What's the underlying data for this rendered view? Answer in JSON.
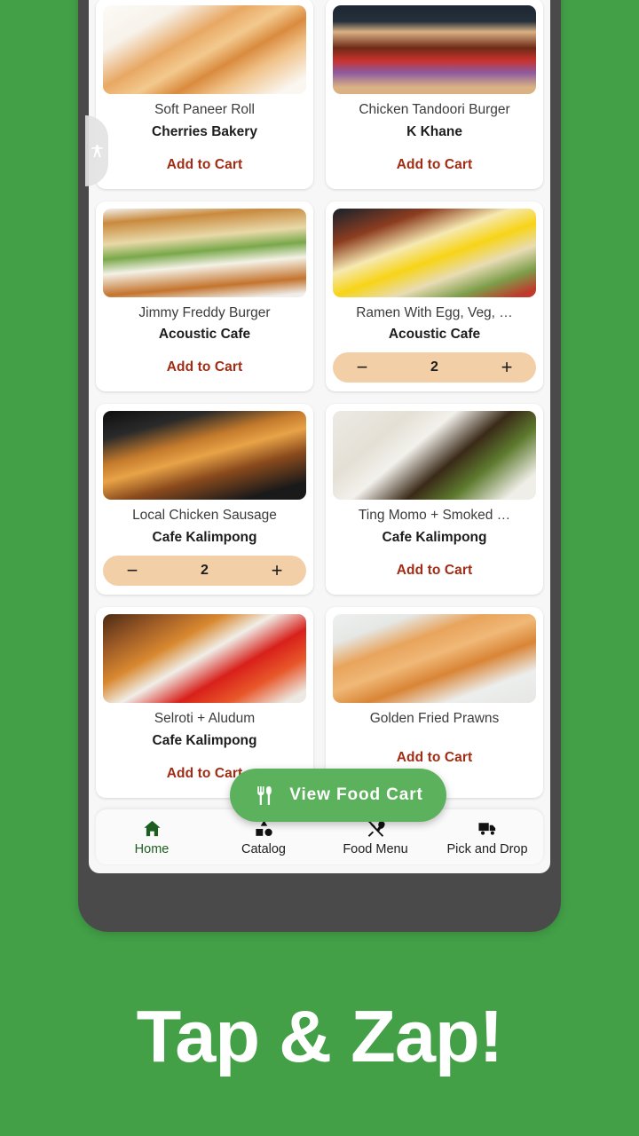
{
  "theme": {
    "background_green": "#43a047",
    "frame_gray": "#4a4a4a",
    "screen_bg": "#f7f7f7",
    "add_to_cart_red": "#a02c14",
    "stepper_peach": "#f2cfa7",
    "cart_button_green": "#5cb25c",
    "active_nav_green": "#1b5e20"
  },
  "accessibility_tab": {
    "icon": "accessibility-icon"
  },
  "products": {
    "rows": [
      {
        "partial": true,
        "cards": [
          {
            "title": "",
            "vendor": "",
            "photo": "",
            "action": "none"
          },
          {
            "title": "",
            "vendor": "",
            "photo": "",
            "action": "none"
          }
        ]
      },
      {
        "partial": false,
        "cards": [
          {
            "title": "Soft Paneer Roll",
            "vendor": "Cherries Bakery",
            "photo": "ph-paneer",
            "action": "add",
            "action_label": "Add to Cart"
          },
          {
            "title": "Chicken Tandoori Burger",
            "vendor": "K Khane",
            "photo": "ph-tandoori",
            "action": "add",
            "action_label": "Add to Cart"
          }
        ]
      },
      {
        "partial": false,
        "cards": [
          {
            "title": "Jimmy Freddy Burger",
            "vendor": "Acoustic Cafe",
            "photo": "ph-jimmy",
            "action": "add",
            "action_label": "Add to Cart"
          },
          {
            "title": "Ramen With Egg, Veg, …",
            "vendor": "Acoustic Cafe",
            "photo": "ph-ramen",
            "action": "stepper",
            "quantity": "2",
            "minus": "−",
            "plus": "+"
          }
        ]
      },
      {
        "partial": false,
        "cards": [
          {
            "title": "Local Chicken Sausage",
            "vendor": "Cafe Kalimpong",
            "photo": "ph-sausage",
            "action": "stepper",
            "quantity": "2",
            "minus": "−",
            "plus": "+"
          },
          {
            "title": "Ting Momo + Smoked …",
            "vendor": "Cafe Kalimpong",
            "photo": "ph-tingmomo",
            "action": "add",
            "action_label": "Add to Cart"
          }
        ]
      },
      {
        "partial": false,
        "cards": [
          {
            "title": "Selroti + Aludum",
            "vendor": "Cafe Kalimpong",
            "photo": "ph-selroti",
            "action": "add",
            "action_label": "Add to Cart"
          },
          {
            "title": "Golden Fried Prawns",
            "vendor": "",
            "photo": "ph-prawns",
            "action": "add",
            "action_label": "Add to Cart"
          }
        ]
      }
    ]
  },
  "view_cart_button": {
    "label": "View Food Cart",
    "icon": "fork-knife-icon"
  },
  "bottom_nav": {
    "items": [
      {
        "label": "Home",
        "icon": "home-icon",
        "active": true
      },
      {
        "label": "Catalog",
        "icon": "shapes-icon",
        "active": false
      },
      {
        "label": "Food Menu",
        "icon": "fork-spoon-crossed-icon",
        "active": false
      },
      {
        "label": "Pick and Drop",
        "icon": "truck-icon",
        "active": false
      }
    ]
  },
  "tagline": {
    "text": "Tap & Zap!"
  }
}
